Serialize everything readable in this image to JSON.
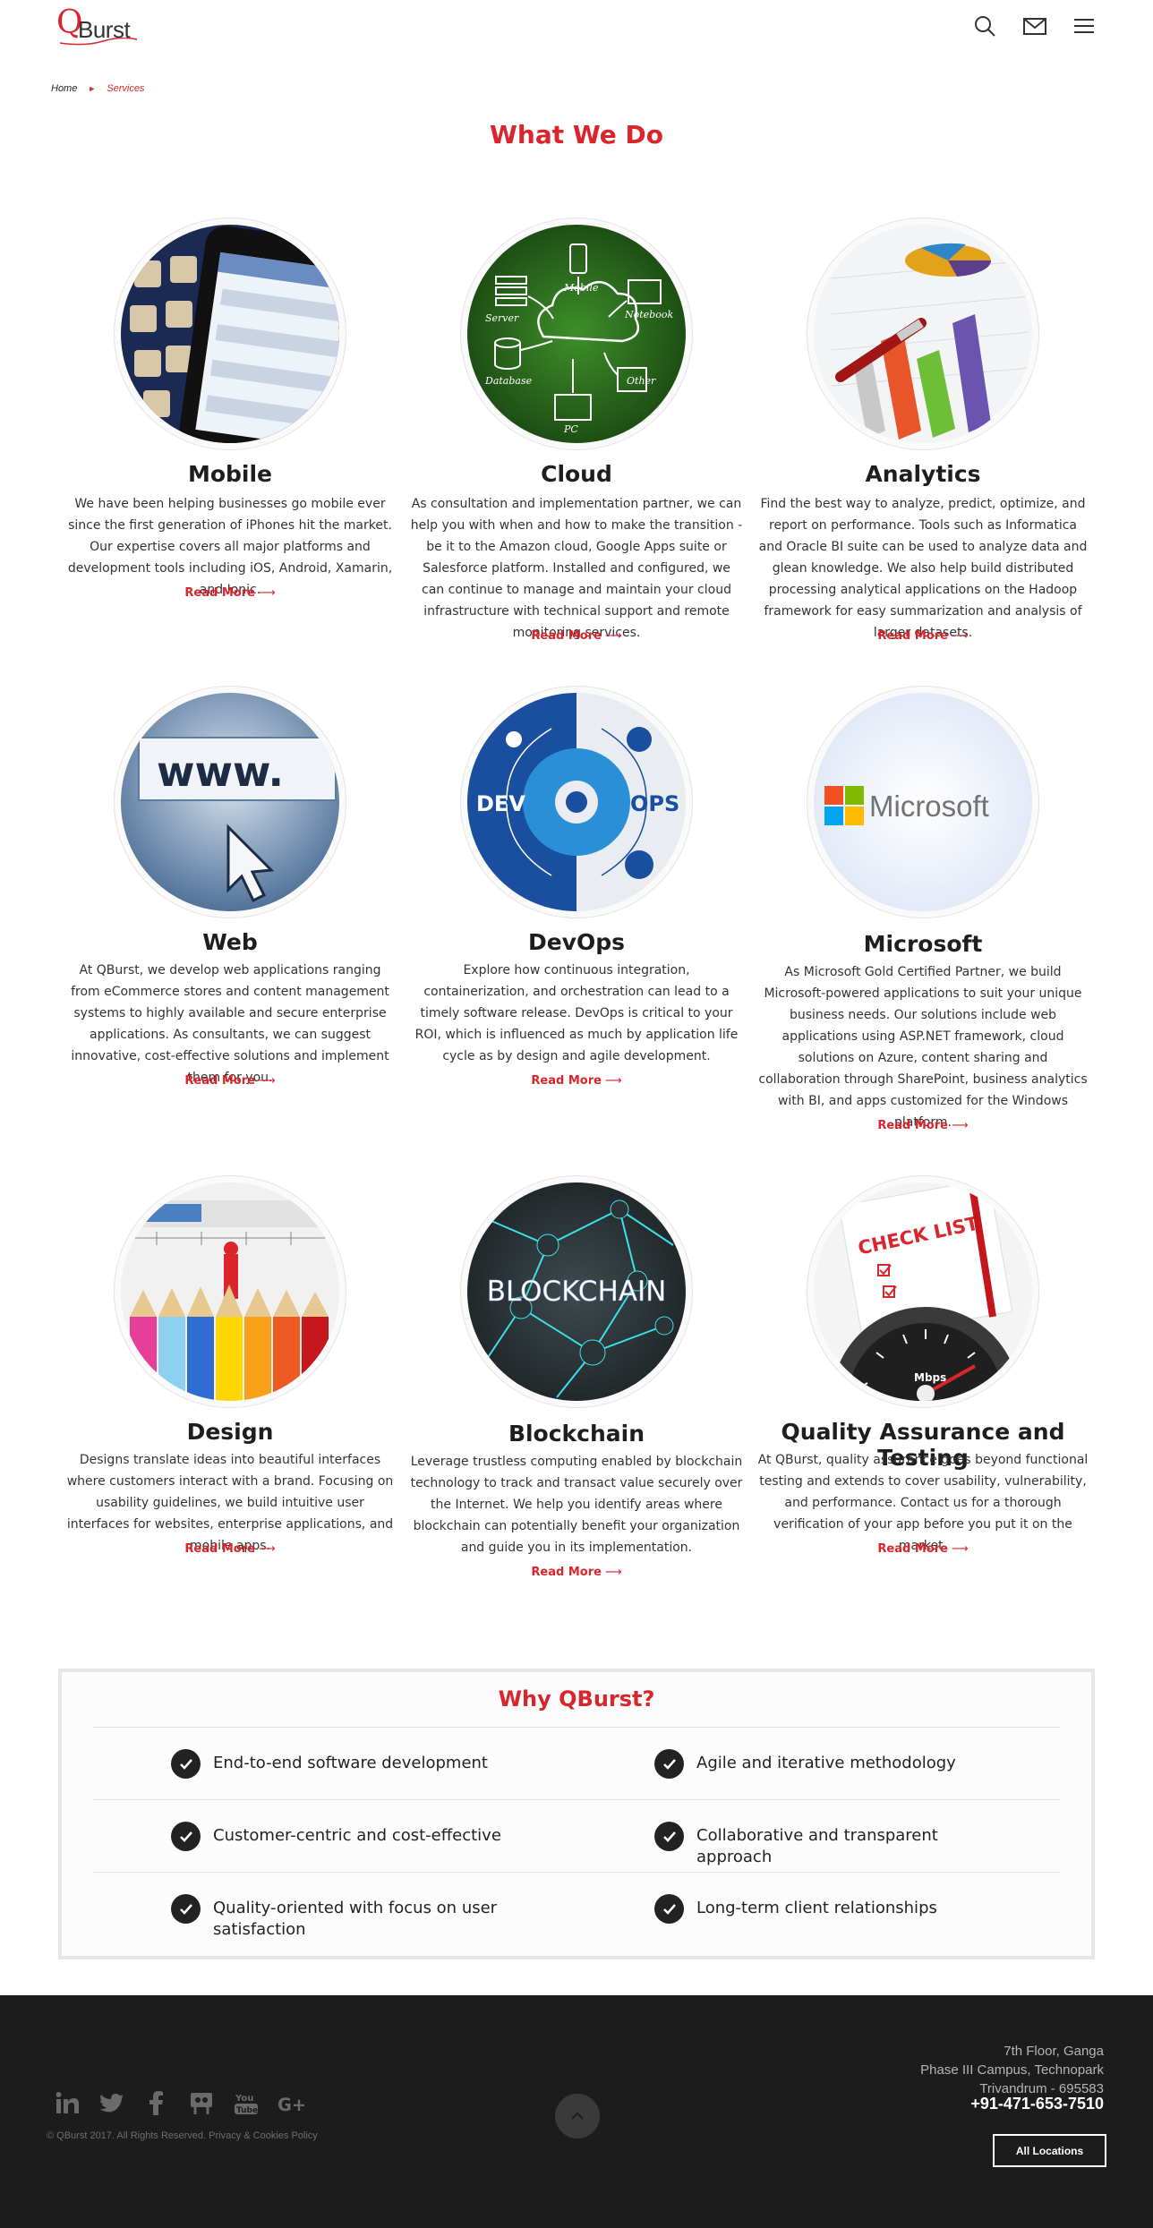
{
  "header": {
    "logo_q": "Q",
    "logo_text": "Burst",
    "icons": [
      "search-icon",
      "mail-icon",
      "menu-icon"
    ]
  },
  "breadcrumb": {
    "home": "Home",
    "separator": "►",
    "current": "Services"
  },
  "page_title": "What We Do",
  "services": [
    {
      "title": "Mobile",
      "description": "We have been helping businesses go mobile ever since the first generation of iPhones hit the market. Our expertise covers all major platforms and development tools including iOS, Android, Xamarin, and Ionic.",
      "read_more": "Read More"
    },
    {
      "title": "Cloud",
      "description": "As consultation and implementation partner, we can help you with when and how to make the transition - be it to the Amazon cloud, Google Apps suite or Salesforce platform. Installed and configured, we can continue to manage and maintain your cloud infrastructure with technical support and remote monitoring services.",
      "read_more": "Read More",
      "image_labels": {
        "server": "Server",
        "mobile": "Mobile",
        "notebook": "Notebook",
        "database": "Database",
        "other": "Other",
        "pc": "PC"
      }
    },
    {
      "title": "Analytics",
      "description": "Find the best way to analyze, predict, optimize, and report on performance. Tools such as Informatica and Oracle BI suite can be used to analyze data and glean knowledge. We also help build distributed processing analytical applications on the Hadoop framework for easy summarization and analysis of larger datasets.",
      "read_more": "Read More"
    },
    {
      "title": "Web",
      "description": "At QBurst, we develop web applications ranging from eCommerce stores and content management systems to highly available and secure enterprise applications. As consultants, we can suggest innovative, cost-effective solutions and implement them for you.",
      "read_more": "Read More",
      "image_labels": {
        "www": "www."
      }
    },
    {
      "title": "DevOps",
      "description": "Explore how continuous integration, containerization, and orchestration can lead to a timely software release. DevOps is critical to your ROI, which is influenced as much by application life cycle as by design and agile development.",
      "read_more": "Read More",
      "image_labels": {
        "dev": "DEV",
        "ops": "OPS"
      }
    },
    {
      "title": "Microsoft",
      "description": "As Microsoft Gold Certified Partner, we build Microsoft-powered applications to suit your unique business needs. Our solutions include web applications using ASP.NET framework, cloud solutions on Azure, content sharing and collaboration through SharePoint, business analytics with BI, and apps customized for the Windows platform.",
      "read_more": "Read More",
      "image_labels": {
        "brand": "Microsoft"
      }
    },
    {
      "title": "Design",
      "description": "Designs translate ideas into beautiful interfaces where customers interact with a brand. Focusing on usability guidelines, we build intuitive user interfaces for websites, enterprise applications, and mobile apps.",
      "read_more": "Read More"
    },
    {
      "title": "Blockchain",
      "description": "Leverage trustless computing enabled by blockchain technology to track and transact value securely over the Internet. We help you identify areas where blockchain can potentially benefit your organization and guide you in its implementation.",
      "read_more": "Read More",
      "image_labels": {
        "word": "BLOCKCHAIN"
      }
    },
    {
      "title": "Quality Assurance and Testing",
      "description": "At QBurst, quality assurance goes beyond functional testing and extends to cover usability, vulnerability, and performance. Contact us for a thorough verification of your app before you put it on the market.",
      "read_more": "Read More",
      "image_labels": {
        "checklist": "CHECK LIST",
        "unit": "Mbps"
      }
    }
  ],
  "why": {
    "title": "Why QBurst?",
    "items": [
      "End-to-end software development",
      "Agile and iterative methodology",
      "Customer-centric and cost-effective",
      "Collaborative and transparent approach",
      "Quality-oriented with focus on user satisfaction",
      "Long-term client relationships"
    ]
  },
  "footer": {
    "social_icons": [
      "linkedin-icon",
      "twitter-icon",
      "facebook-icon",
      "slideshare-icon",
      "youtube-icon",
      "google-plus-icon"
    ],
    "copyright": "© QBurst 2017. All Rights Reserved.",
    "policy_link": "Privacy & Cookies Policy",
    "address_lines": [
      "7th Floor, Ganga",
      "Phase III Campus, Technopark",
      "Trivandrum - 695583"
    ],
    "phone": "+91-471-653-7510",
    "locations_button": "All Locations"
  },
  "colors": {
    "brand_red": "#d9252b",
    "footer_bg": "#1c1c1c",
    "text_dark": "#1e1e1e"
  }
}
